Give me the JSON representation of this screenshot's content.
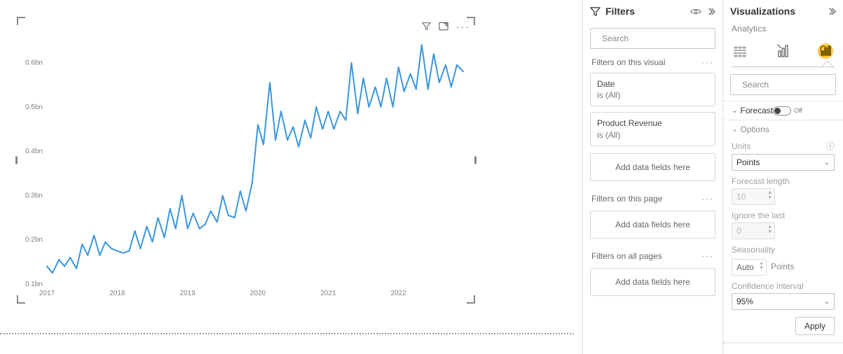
{
  "chart_data": {
    "type": "line",
    "title": "",
    "xlabel": "",
    "ylabel": "",
    "ylim": [
      0.1,
      0.65
    ],
    "y_ticks": [
      "0.1bn",
      "0.2bn",
      "0.3bn",
      "0.4bn",
      "0.5bn",
      "0.6bn"
    ],
    "x_ticks": [
      "2017",
      "2018",
      "2019",
      "2020",
      "2021",
      "2022"
    ],
    "x": [
      2017.0,
      2017.08,
      2017.17,
      2017.25,
      2017.33,
      2017.42,
      2017.5,
      2017.58,
      2017.67,
      2017.75,
      2017.83,
      2017.92,
      2018.0,
      2018.08,
      2018.17,
      2018.25,
      2018.33,
      2018.42,
      2018.5,
      2018.58,
      2018.67,
      2018.75,
      2018.83,
      2018.92,
      2019.0,
      2019.08,
      2019.17,
      2019.25,
      2019.33,
      2019.42,
      2019.5,
      2019.58,
      2019.67,
      2019.75,
      2019.83,
      2019.92,
      2020.0,
      2020.08,
      2020.17,
      2020.25,
      2020.33,
      2020.42,
      2020.5,
      2020.58,
      2020.67,
      2020.75,
      2020.83,
      2020.92,
      2021.0,
      2021.08,
      2021.17,
      2021.25,
      2021.33,
      2021.42,
      2021.5,
      2021.58,
      2021.67,
      2021.75,
      2021.83,
      2021.92,
      2022.0,
      2022.08,
      2022.17,
      2022.25,
      2022.33,
      2022.42,
      2022.5,
      2022.58,
      2022.67,
      2022.75,
      2022.83,
      2022.92
    ],
    "values": [
      0.14,
      0.125,
      0.155,
      0.14,
      0.16,
      0.135,
      0.19,
      0.165,
      0.21,
      0.165,
      0.195,
      0.18,
      0.175,
      0.17,
      0.175,
      0.22,
      0.18,
      0.23,
      0.195,
      0.25,
      0.205,
      0.27,
      0.225,
      0.3,
      0.225,
      0.26,
      0.225,
      0.235,
      0.265,
      0.24,
      0.3,
      0.255,
      0.25,
      0.31,
      0.265,
      0.33,
      0.46,
      0.415,
      0.555,
      0.425,
      0.49,
      0.425,
      0.455,
      0.41,
      0.47,
      0.43,
      0.5,
      0.45,
      0.49,
      0.45,
      0.49,
      0.47,
      0.6,
      0.485,
      0.565,
      0.5,
      0.545,
      0.5,
      0.565,
      0.5,
      0.59,
      0.535,
      0.575,
      0.54,
      0.64,
      0.54,
      0.62,
      0.555,
      0.595,
      0.545,
      0.595,
      0.58
    ]
  },
  "visual_header": {
    "filter_icon": "filter-icon",
    "focus_icon": "focus-mode-icon",
    "more_icon": "more-options"
  },
  "filters_panel": {
    "title": "Filters",
    "search_placeholder": "Search",
    "section_visual": "Filters on this visual",
    "card_date_title": "Date",
    "card_date_sub": "is (All)",
    "card_rev_title": "Product Revenue",
    "card_rev_sub": "is (All)",
    "add_visual": "Add data fields here",
    "section_page": "Filters on this page",
    "add_page": "Add data fields here",
    "section_all": "Filters on all pages",
    "add_all": "Add data fields here"
  },
  "viz_panel": {
    "title": "Visualizations",
    "subtitle": "Analytics",
    "search_placeholder": "Search",
    "forecast_label": "Forecast",
    "forecast_toggle_text": "Off",
    "options_label": "Options",
    "units_label": "Units",
    "units_value": "Points",
    "flen_label": "Forecast length",
    "flen_value": "10",
    "ignore_label": "Ignore the last",
    "ignore_value": "0",
    "season_label": "Seasonality",
    "season_value": "Auto",
    "season_unit": "Points",
    "conf_label": "Confidence interval",
    "conf_value": "95%",
    "apply_label": "Apply"
  }
}
